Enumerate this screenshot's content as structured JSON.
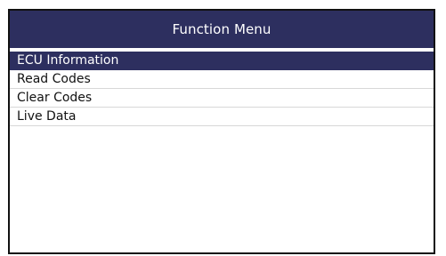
{
  "header": {
    "title": "Function Menu"
  },
  "menu": {
    "items": [
      {
        "label": "ECU Information",
        "selected": true
      },
      {
        "label": "Read Codes",
        "selected": false
      },
      {
        "label": "Clear Codes",
        "selected": false
      },
      {
        "label": "Live Data",
        "selected": false
      }
    ]
  },
  "colors": {
    "accent": "#2d2f5f",
    "selected_text": "#ffffff",
    "text": "#111111",
    "row_divider": "#d7d7d7"
  }
}
